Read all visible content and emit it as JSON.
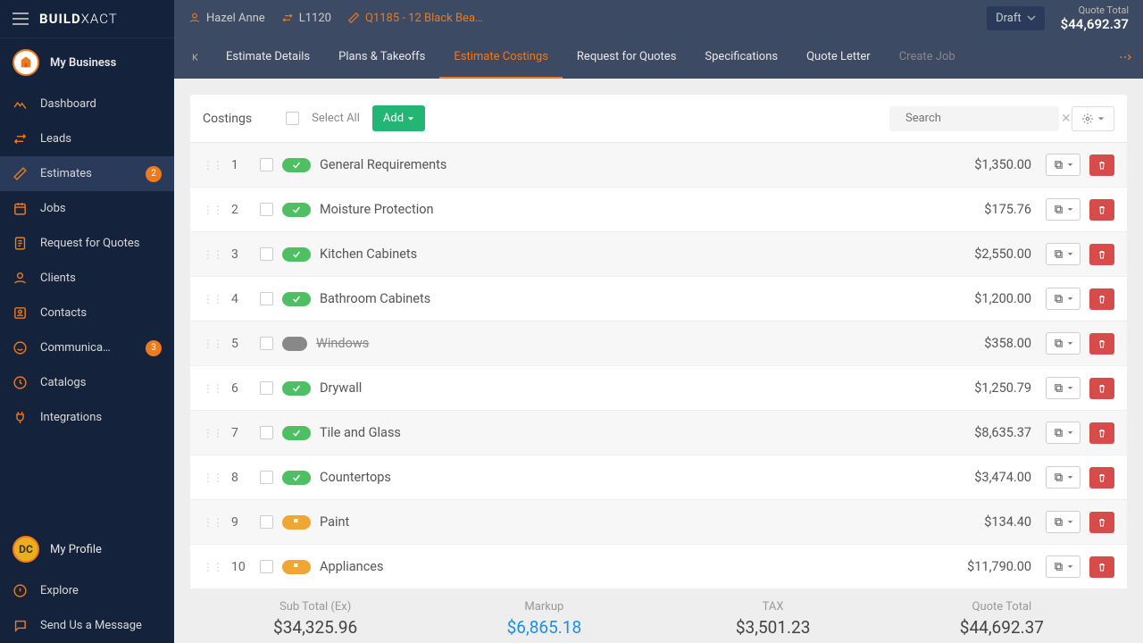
{
  "brand": "BUILDXACT",
  "business_label": "My Business",
  "nav": [
    {
      "icon": "dashboard",
      "label": "Dashboard"
    },
    {
      "icon": "leads",
      "label": "Leads"
    },
    {
      "icon": "estimates",
      "label": "Estimates",
      "badge": "2",
      "active": true
    },
    {
      "icon": "jobs",
      "label": "Jobs"
    },
    {
      "icon": "rfq",
      "label": "Request for Quotes"
    },
    {
      "icon": "clients",
      "label": "Clients"
    },
    {
      "icon": "contacts",
      "label": "Contacts"
    },
    {
      "icon": "comm",
      "label": "Communica…",
      "badge": "3"
    },
    {
      "icon": "catalog",
      "label": "Catalogs"
    },
    {
      "icon": "integrations",
      "label": "Integrations"
    }
  ],
  "profile": {
    "initials": "DC",
    "label": "My Profile"
  },
  "footer_nav": [
    {
      "icon": "explore",
      "label": "Explore"
    },
    {
      "icon": "message",
      "label": "Send Us a Message"
    }
  ],
  "breadcrumb": {
    "user": "Hazel Anne",
    "code": "L1120",
    "job": "Q1185 - 12 Black Bea…"
  },
  "status_dropdown": "Draft",
  "quote_total_label": "Quote Total",
  "quote_total_amount": "$44,692.37",
  "tabs": [
    "Estimate Details",
    "Plans & Takeoffs",
    "Estimate Costings",
    "Request for Quotes",
    "Specifications",
    "Quote Letter",
    "Create Job"
  ],
  "active_tab": 2,
  "toolbar": {
    "title": "Costings",
    "select_all": "Select All",
    "add": "Add",
    "search_placeholder": "Search"
  },
  "rows": [
    {
      "n": "1",
      "status": "check",
      "name": "General Requirements",
      "amt": "$1,350.00"
    },
    {
      "n": "2",
      "status": "check",
      "name": "Moisture Protection",
      "amt": "$175.76"
    },
    {
      "n": "3",
      "status": "check",
      "name": "Kitchen Cabinets",
      "amt": "$2,550.00"
    },
    {
      "n": "4",
      "status": "check",
      "name": "Bathroom Cabinets",
      "amt": "$1,200.00"
    },
    {
      "n": "5",
      "status": "disabled",
      "name": "Windows",
      "amt": "$358.00",
      "strike": true
    },
    {
      "n": "6",
      "status": "check",
      "name": "Drywall",
      "amt": "$1,250.79"
    },
    {
      "n": "7",
      "status": "check",
      "name": "Tile and Glass",
      "amt": "$8,635.37"
    },
    {
      "n": "8",
      "status": "check",
      "name": "Countertops",
      "amt": "$3,474.00"
    },
    {
      "n": "9",
      "status": "flag",
      "name": "Paint",
      "amt": "$134.40"
    },
    {
      "n": "10",
      "status": "flag",
      "name": "Appliances",
      "amt": "$11,790.00"
    }
  ],
  "totals": [
    {
      "label": "Sub Total (Ex)",
      "value": "$34,325.96"
    },
    {
      "label": "Markup",
      "value": "$6,865.18",
      "blue": true
    },
    {
      "label": "TAX",
      "value": "$3,501.23"
    },
    {
      "label": "Quote Total",
      "value": "$44,692.37"
    }
  ]
}
